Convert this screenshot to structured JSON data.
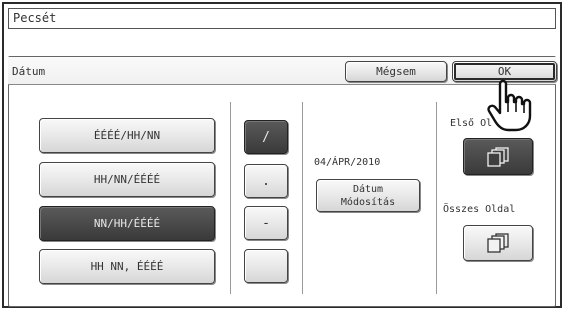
{
  "window": {
    "title": "Pecsét"
  },
  "panel": {
    "title": "Dátum"
  },
  "actions": {
    "cancel_label": "Mégsem",
    "ok_label": "OK"
  },
  "formats": [
    {
      "label": "ÉÉÉÉ/HH/NN",
      "selected": false
    },
    {
      "label": "HH/NN/ÉÉÉÉ",
      "selected": false
    },
    {
      "label": "NN/HH/ÉÉÉÉ",
      "selected": true
    },
    {
      "label": "HH NN, ÉÉÉÉ",
      "selected": false
    }
  ],
  "separators": [
    {
      "label": "/",
      "selected": true
    },
    {
      "label": ".",
      "selected": false
    },
    {
      "label": "-",
      "selected": false
    },
    {
      "label": "",
      "selected": false
    }
  ],
  "date": {
    "current_value": "04/ÁPR/2010",
    "modify_label_line1": "Dátum",
    "modify_label_line2": "Módosítás"
  },
  "pages": {
    "first_page_label": "Első Ol",
    "all_pages_label": "Összes Oldal",
    "first_page_selected": true,
    "all_pages_selected": false
  },
  "icons": {
    "first_page": "stacked-pages-icon",
    "all_pages": "stacked-pages-icon",
    "pointer": "hand-pointer-icon"
  },
  "colors": {
    "selected_bg": "#3f3f3f",
    "button_bg": "#e6e6e6"
  }
}
